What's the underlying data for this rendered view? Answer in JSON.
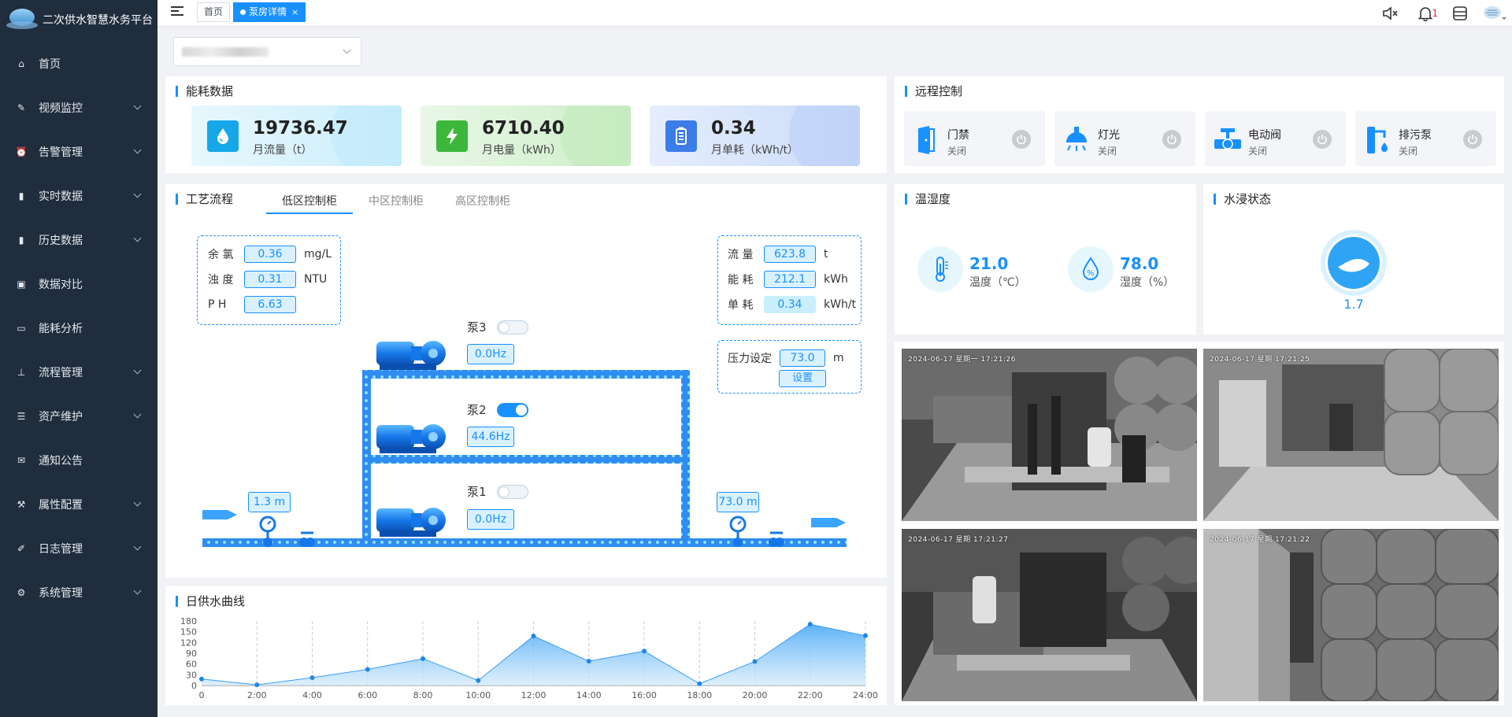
{
  "app": {
    "title": "二次供水智慧水务平台"
  },
  "sidebar": {
    "items": [
      {
        "label": "首页",
        "icon": "home-icon",
        "expand": false
      },
      {
        "label": "视频监控",
        "icon": "camera-icon",
        "expand": true
      },
      {
        "label": "告警管理",
        "icon": "alarm-icon",
        "expand": true
      },
      {
        "label": "实时数据",
        "icon": "bar-chart-icon",
        "expand": true
      },
      {
        "label": "历史数据",
        "icon": "bar-chart-icon",
        "expand": true
      },
      {
        "label": "数据对比",
        "icon": "compare-icon",
        "expand": false
      },
      {
        "label": "能耗分析",
        "icon": "monitor-icon",
        "expand": false
      },
      {
        "label": "流程管理",
        "icon": "tree-icon",
        "expand": true
      },
      {
        "label": "资产维护",
        "icon": "list-icon",
        "expand": true
      },
      {
        "label": "通知公告",
        "icon": "message-icon",
        "expand": false
      },
      {
        "label": "属性配置",
        "icon": "wrench-icon",
        "expand": true
      },
      {
        "label": "日志管理",
        "icon": "edit-icon",
        "expand": true
      },
      {
        "label": "系统管理",
        "icon": "gear-icon",
        "expand": true
      }
    ]
  },
  "topbar": {
    "tabs": [
      {
        "label": "首页",
        "active": false
      },
      {
        "label": "泵房详情",
        "active": true,
        "close": "×"
      }
    ],
    "alert_count": "1"
  },
  "energy": {
    "title": "能耗数据",
    "cards": [
      {
        "value": "19736.47",
        "label": "月流量（t）",
        "color": "#16a7e8"
      },
      {
        "value": "6710.40",
        "label": "月电量（kWh）",
        "color": "#3cb73c"
      },
      {
        "value": "0.34",
        "label": "月单耗（kWh/t）",
        "color": "#3b7de8"
      }
    ]
  },
  "remote": {
    "title": "远程控制",
    "items": [
      {
        "name": "门禁",
        "status": "关闭"
      },
      {
        "name": "灯光",
        "status": "关闭"
      },
      {
        "name": "电动阀",
        "status": "关闭"
      },
      {
        "name": "排污泵",
        "status": "关闭"
      }
    ]
  },
  "process": {
    "title": "工艺流程",
    "tabs": [
      "低区控制柜",
      "中区控制柜",
      "高区控制柜"
    ],
    "quality": [
      {
        "k": "余 氯",
        "v": "0.36",
        "u": "mg/L"
      },
      {
        "k": "浊 度",
        "v": "0.31",
        "u": "NTU"
      },
      {
        "k": "P H",
        "v": "6.63",
        "u": ""
      }
    ],
    "meter": [
      {
        "k": "流 量",
        "v": "623.8",
        "u": "t"
      },
      {
        "k": "能 耗",
        "v": "212.1",
        "u": "kWh"
      },
      {
        "k": "单 耗",
        "v": "0.34",
        "u": "kWh/t"
      }
    ],
    "pressure": {
      "label": "压力设定",
      "value": "73.0",
      "unit": "m",
      "button": "设置"
    },
    "pumps": [
      {
        "name": "泵3",
        "hz": "0.0Hz",
        "on": false
      },
      {
        "name": "泵2",
        "hz": "44.6Hz",
        "on": true
      },
      {
        "name": "泵1",
        "hz": "0.0Hz",
        "on": false
      }
    ],
    "inlet_pressure": "1.3 m",
    "outlet_pressure": "73.0 m"
  },
  "env": {
    "title": "温湿度",
    "temp_value": "21.0",
    "temp_label": "温度（℃）",
    "hum_value": "78.0",
    "hum_label": "湿度（%）"
  },
  "flood": {
    "title": "水浸状态",
    "value": "1.7"
  },
  "cameras": [
    {
      "ts": "2024-06-17  星期一  17:21:26"
    },
    {
      "ts": "2024-06-17  星期  17:21:25"
    },
    {
      "ts": "2024-06-17  星期  17:21:27"
    },
    {
      "ts": "2024-06-17  星期  17:21:22"
    }
  ],
  "curve": {
    "title": "日供水曲线"
  },
  "chart_data": {
    "type": "area",
    "title": "日供水曲线",
    "x": [
      "0",
      "2:00",
      "4:00",
      "6:00",
      "8:00",
      "10:00",
      "12:00",
      "14:00",
      "16:00",
      "18:00",
      "20:00",
      "22:00",
      "24:00"
    ],
    "values": [
      18,
      2,
      22,
      45,
      75,
      14,
      138,
      68,
      96,
      5,
      67,
      171,
      139
    ],
    "yticks": [
      "180",
      "150",
      "120",
      "90",
      "60",
      "30",
      "0"
    ],
    "ylim": [
      0,
      180
    ],
    "grid": "vertical dashed"
  }
}
